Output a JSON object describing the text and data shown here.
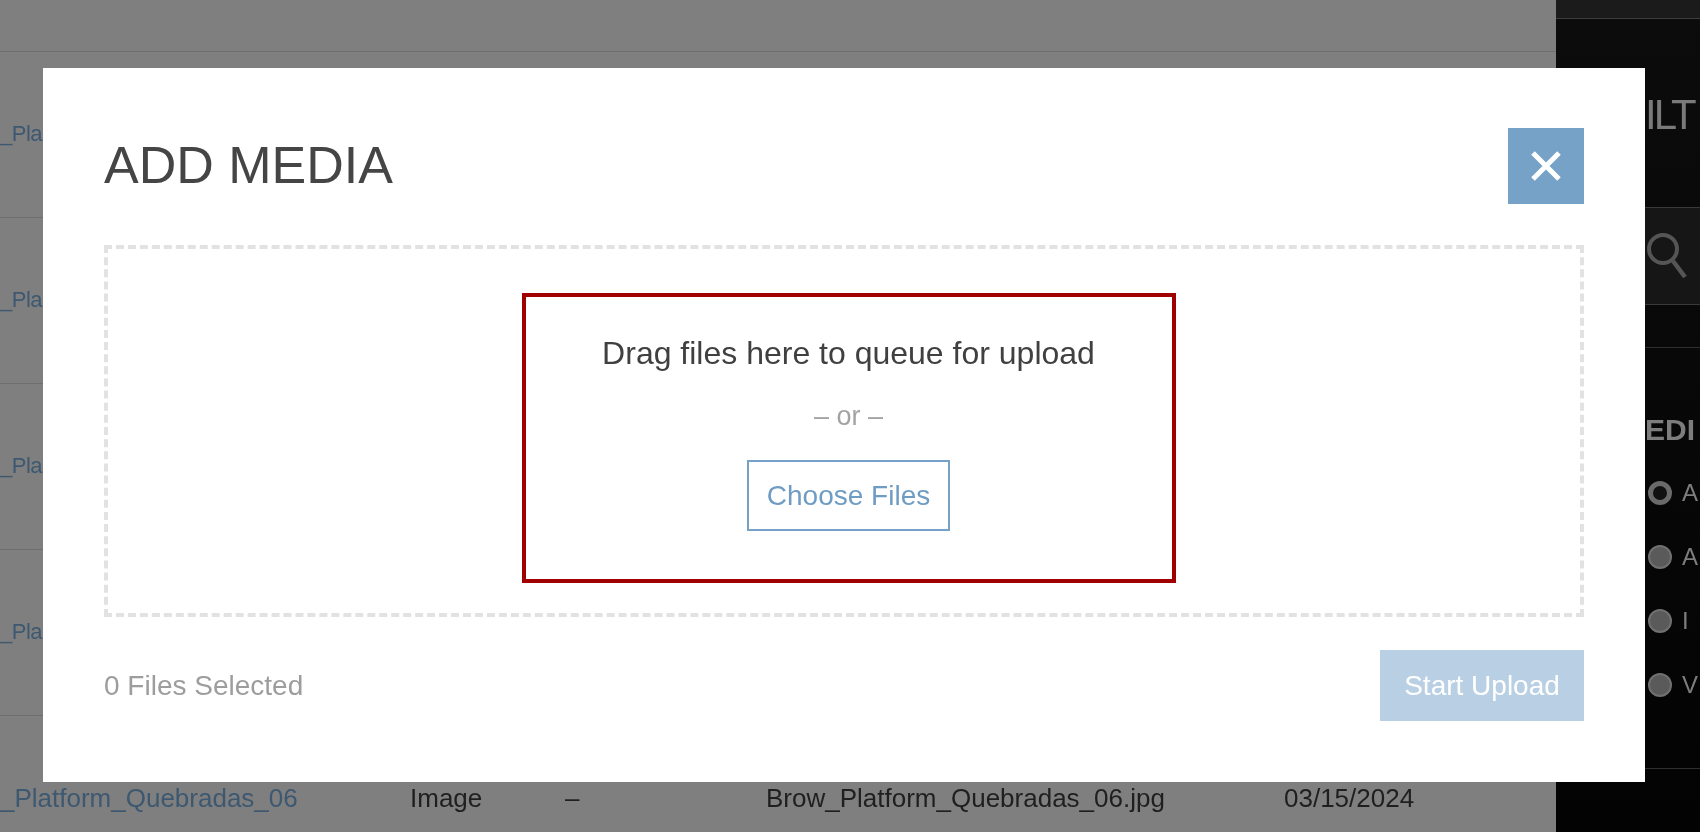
{
  "table": {
    "rows": [
      {
        "cells": [
          "_Pla"
        ]
      },
      {
        "cells": [
          "_Pla"
        ]
      },
      {
        "cells": [
          "_Pla"
        ]
      },
      {
        "cells": [
          "_Pla"
        ]
      },
      {
        "cells": [
          "_Platform_Quebradas_06",
          "Image",
          "–",
          "Brow_Platform_Quebradas_06.jpg",
          "03/15/2024"
        ]
      }
    ]
  },
  "sidebar": {
    "title": "ILT",
    "section_title": "EDI",
    "options": [
      {
        "label": "A",
        "selected": true
      },
      {
        "label": "A",
        "selected": false
      },
      {
        "label": "I",
        "selected": false
      },
      {
        "label": "V",
        "selected": false
      }
    ]
  },
  "dialog": {
    "title": "ADD MEDIA",
    "dropzone": {
      "highlighted": true,
      "instruction": "Drag files here to queue for upload",
      "separator": "– or –",
      "choose_button": "Choose Files"
    },
    "status": "0 Files Selected",
    "start_button": {
      "label": "Start Upload",
      "disabled": true
    }
  }
}
